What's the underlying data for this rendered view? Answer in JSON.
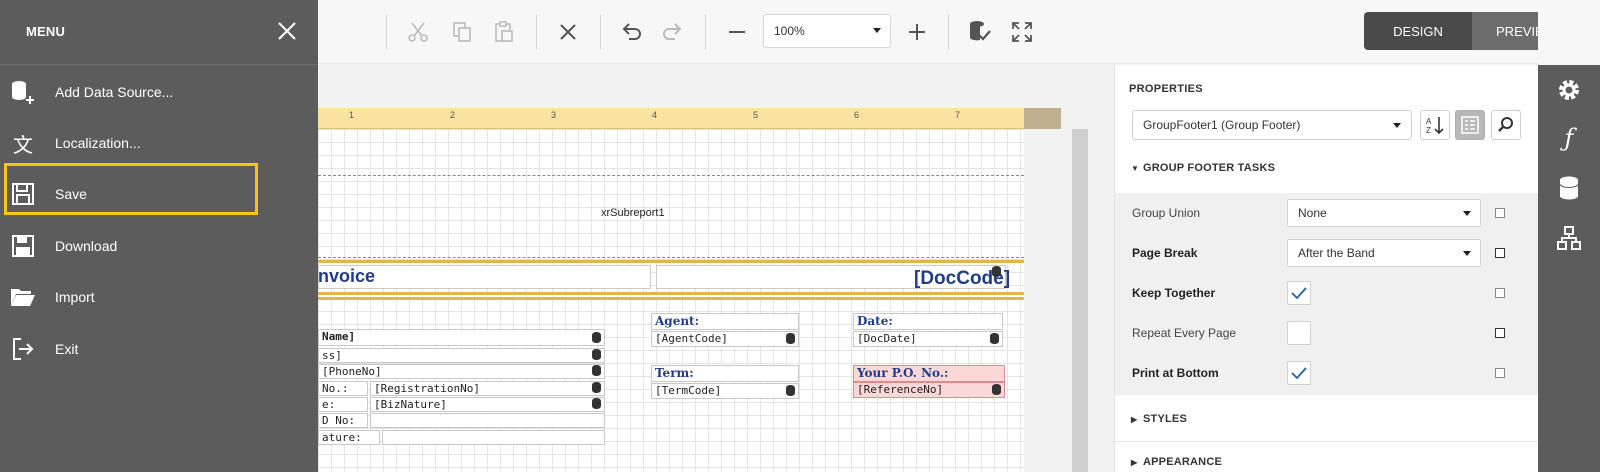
{
  "menu": {
    "title": "MENU",
    "items": [
      {
        "label": "Add Data Source...",
        "icon": "add-data-source-icon"
      },
      {
        "label": "Localization...",
        "icon": "localization-icon"
      },
      {
        "label": "Save",
        "icon": "save-icon"
      },
      {
        "label": "Download",
        "icon": "download-icon"
      },
      {
        "label": "Import",
        "icon": "import-icon"
      },
      {
        "label": "Exit",
        "icon": "exit-icon"
      }
    ],
    "highlighted": "Save"
  },
  "toolbar": {
    "zoom_value": "100%",
    "design_label": "DESIGN",
    "preview_label": "PREVIEW",
    "active_mode": "DESIGN"
  },
  "ruler": {
    "marks": [
      "1",
      "2",
      "3",
      "4",
      "5",
      "6",
      "7"
    ]
  },
  "report": {
    "subreport": "xrSubreport1",
    "title": "nvoice",
    "doccode": "[DocCode]",
    "fields_left": [
      "Name]",
      "ss]",
      "[PhoneNo]",
      "No.:",
      "[RegistrationNo]",
      "e:",
      "[BizNature]",
      "D No:",
      "ature:"
    ],
    "agent_label": "Agent:",
    "agent_value": "[AgentCode]",
    "term_label": "Term:",
    "term_value": "[TermCode]",
    "date_label": "Date:",
    "date_value": "[DocDate]",
    "po_label": "Your P.O. No.:",
    "po_value": "[ReferenceNo]"
  },
  "properties": {
    "title": "PROPERTIES",
    "selected_component": "GroupFooter1 (Group Footer)",
    "tasks_section": "GROUP FOOTER TASKS",
    "rows": [
      {
        "label": "Group Union",
        "type": "dropdown",
        "value": "None",
        "bold": false
      },
      {
        "label": "Page Break",
        "type": "dropdown",
        "value": "After the Band",
        "bold": true
      },
      {
        "label": "Keep Together",
        "type": "checkbox",
        "checked": true,
        "bold": true
      },
      {
        "label": "Repeat Every Page",
        "type": "checkbox",
        "checked": false,
        "bold": false
      },
      {
        "label": "Print at Bottom",
        "type": "checkbox",
        "checked": true,
        "bold": true
      }
    ],
    "styles_section": "STYLES",
    "appearance_section": "APPEARANCE"
  },
  "colors": {
    "menu_bg": "#5c5c5c",
    "highlight": "#f5c518",
    "accent_blue": "#1e5fa8",
    "report_blue": "#1f3c88"
  }
}
